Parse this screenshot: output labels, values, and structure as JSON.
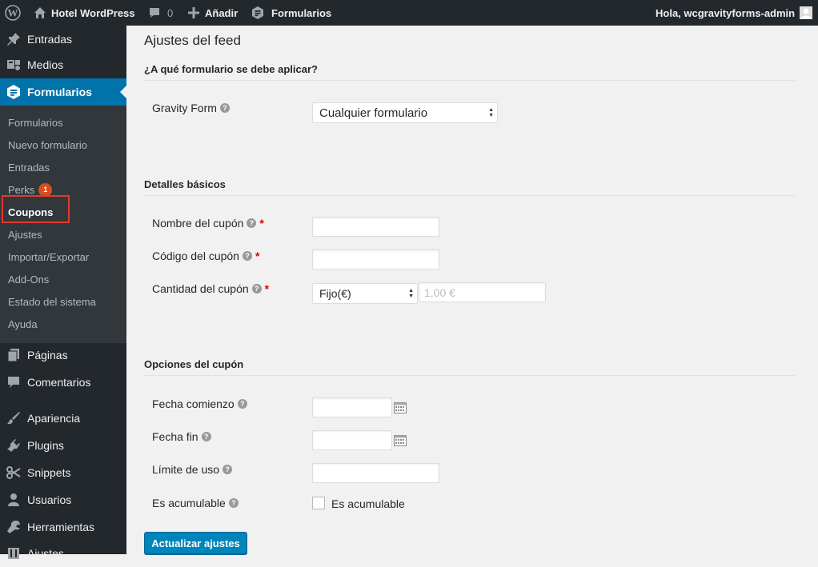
{
  "adminbar": {
    "site_name": "Hotel WordPress",
    "comments_count": "0",
    "new_label": "Añadir",
    "forms_label": "Formularios",
    "greeting": "Hola, wcgravityforms-admin"
  },
  "sidebar": {
    "top_items": [
      {
        "label": "Entradas",
        "icon": "pin-icon"
      },
      {
        "label": "Medios",
        "icon": "media-icon"
      },
      {
        "label": "Formularios",
        "icon": "forms-icon"
      }
    ],
    "submenu": [
      {
        "label": "Formularios"
      },
      {
        "label": "Nuevo formulario"
      },
      {
        "label": "Entradas"
      },
      {
        "label": "Perks",
        "badge": "1"
      },
      {
        "label": "Coupons"
      },
      {
        "label": "Ajustes"
      },
      {
        "label": "Importar/Exportar"
      },
      {
        "label": "Add-Ons"
      },
      {
        "label": "Estado del sistema"
      },
      {
        "label": "Ayuda"
      }
    ],
    "bottom_items": [
      {
        "label": "Páginas",
        "icon": "pages-icon"
      },
      {
        "label": "Comentarios",
        "icon": "comments-icon"
      },
      {
        "label": "Apariencia",
        "icon": "brush-icon"
      },
      {
        "label": "Plugins",
        "icon": "plugin-icon"
      },
      {
        "label": "Snippets",
        "icon": "scissors-icon"
      },
      {
        "label": "Usuarios",
        "icon": "users-icon"
      },
      {
        "label": "Herramientas",
        "icon": "wrench-icon"
      },
      {
        "label": "Ajustes",
        "icon": "settings-icon"
      }
    ]
  },
  "main": {
    "page_title": "Ajustes del feed",
    "section_form": "¿A qué formulario se debe aplicar?",
    "gravity_form_label": "Gravity Form",
    "gravity_form_value": "Cualquier formulario",
    "section_basic": "Detalles básicos",
    "coupon_name_label": "Nombre del cupón",
    "coupon_code_label": "Código del cupón",
    "coupon_amount_label": "Cantidad del cupón",
    "amount_type_value": "Fijo(€)",
    "amount_placeholder": "1,00 €",
    "section_options": "Opciones del cupón",
    "start_date_label": "Fecha comienzo",
    "end_date_label": "Fecha fin",
    "usage_limit_label": "Límite de uso",
    "stackable_label": "Es acumulable",
    "stackable_checkbox_label": "Es acumulable",
    "required_mark": "*",
    "help_glyph": "?",
    "update_button": "Actualizar ajustes"
  },
  "colors": {
    "adminbar_bg": "#23282d",
    "accent": "#0073aa",
    "button": "#0085ba",
    "highlight": "#e23a2e"
  }
}
